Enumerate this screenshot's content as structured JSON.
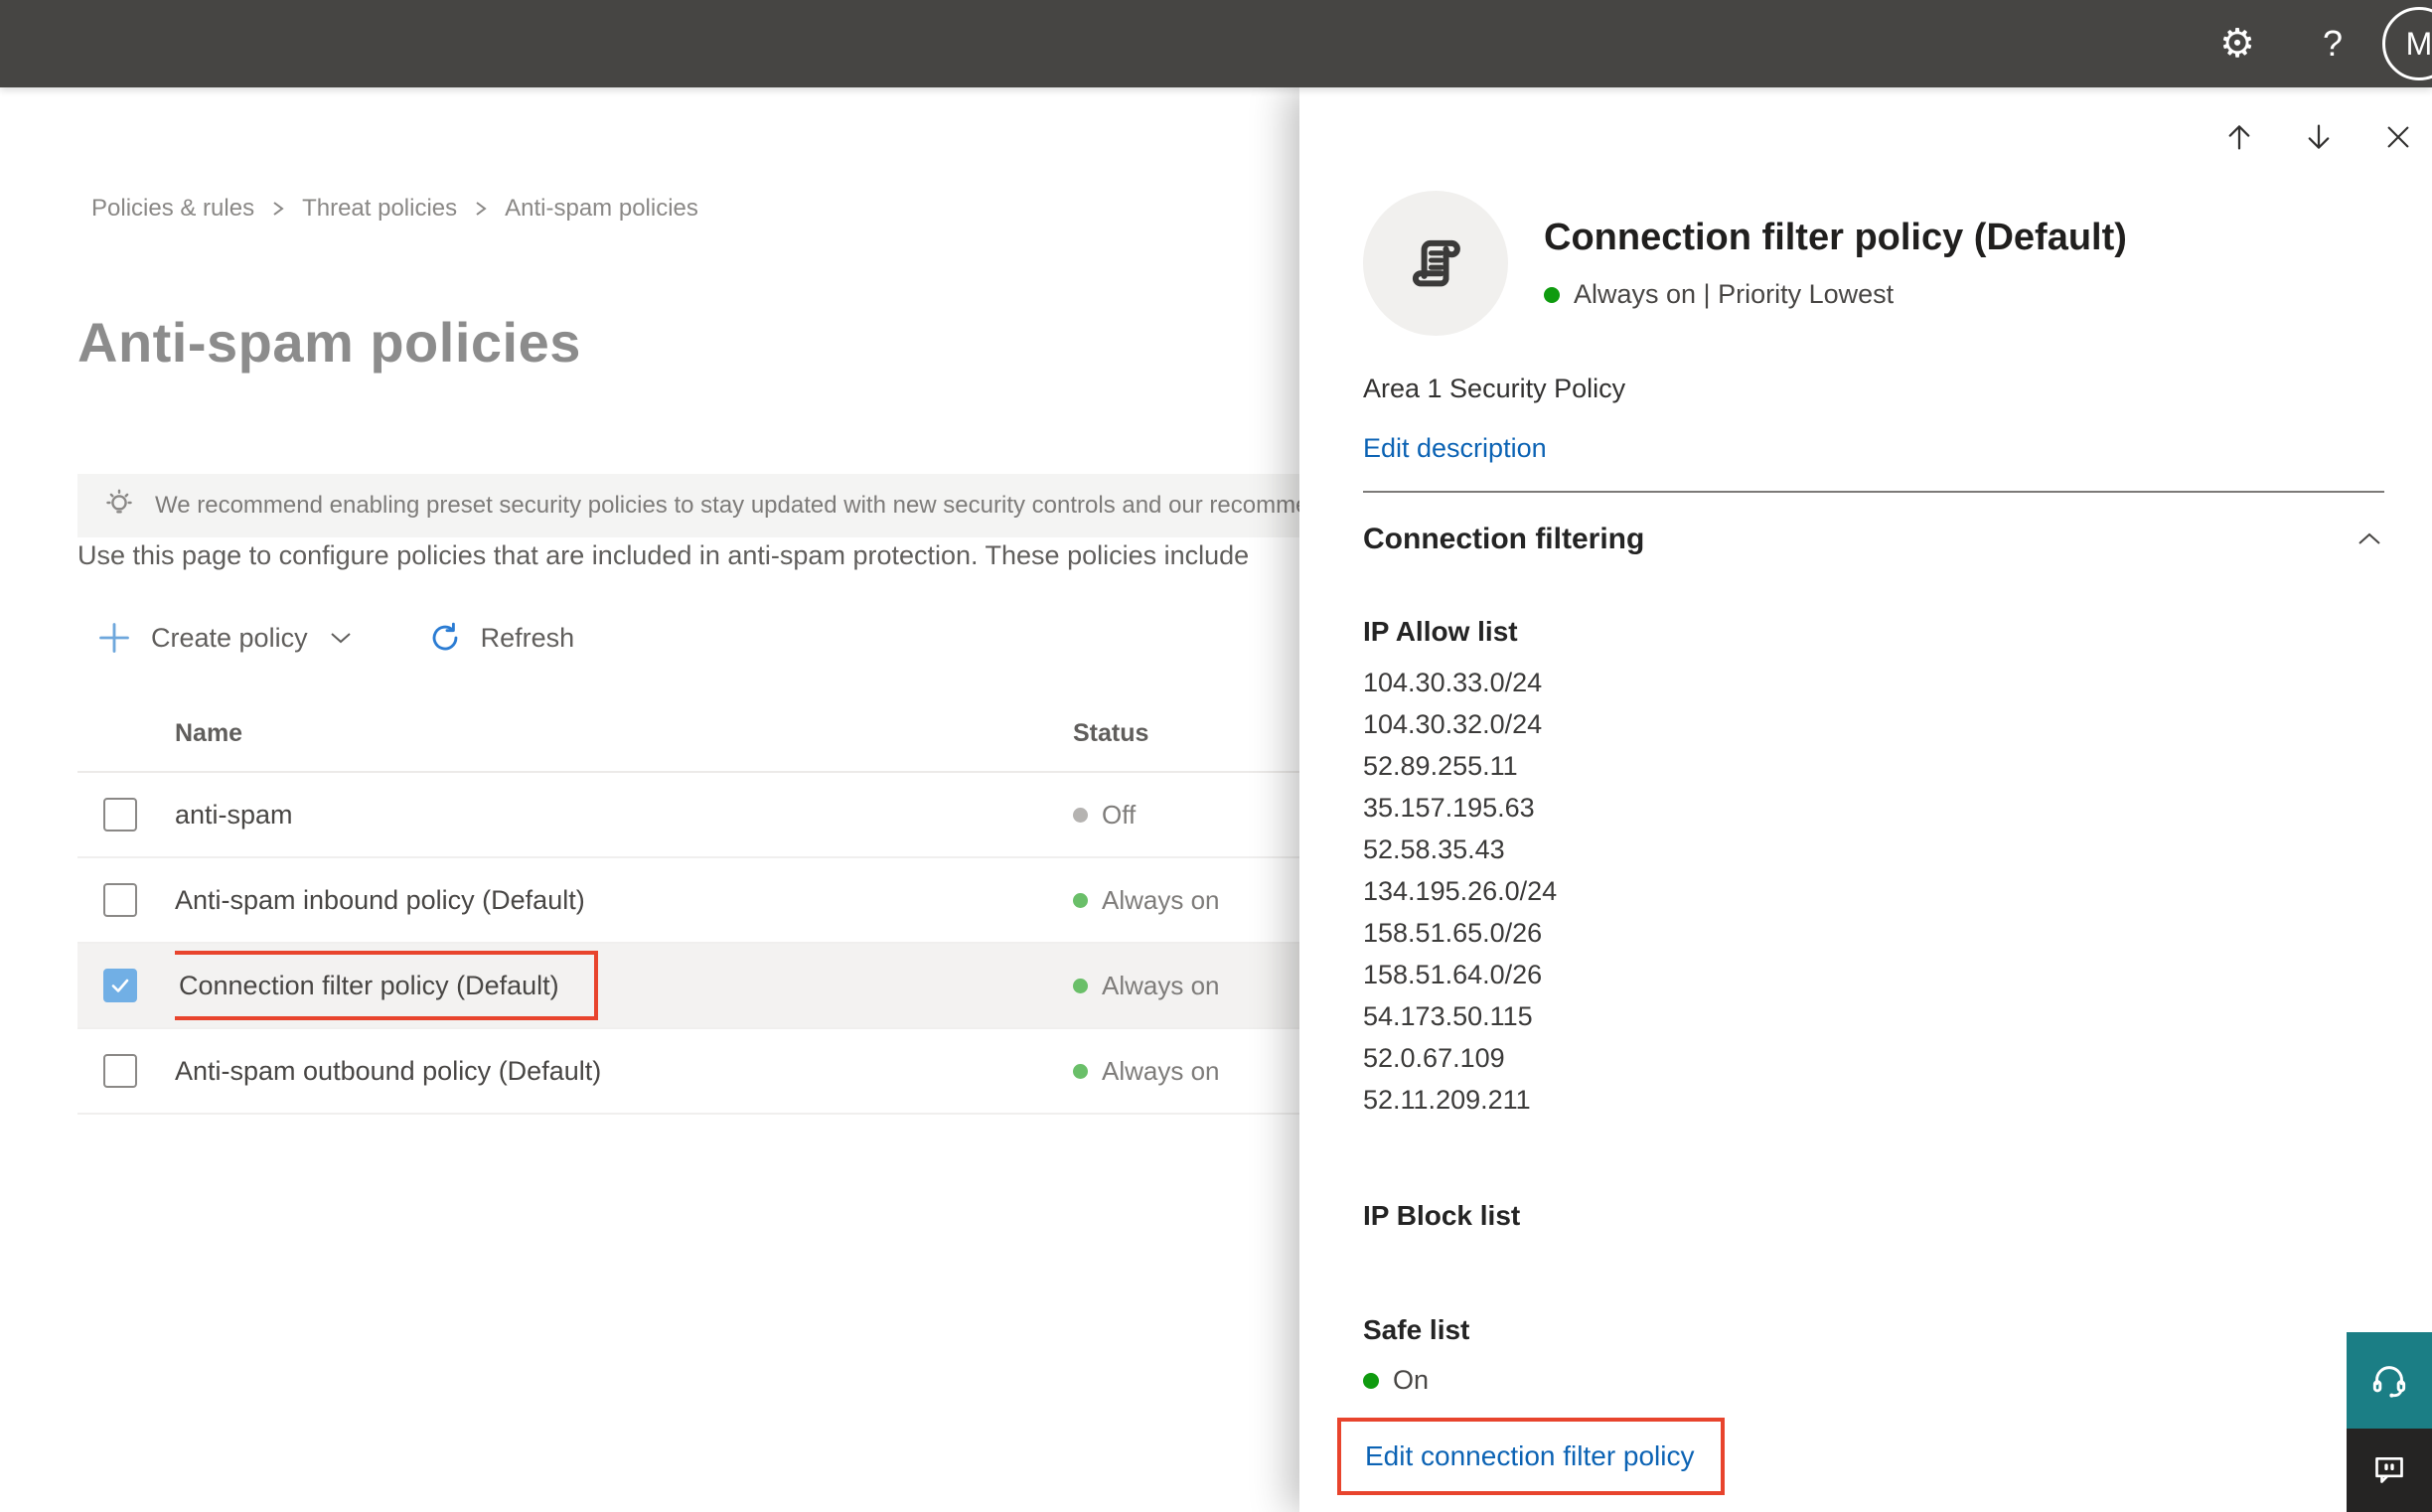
{
  "topbar": {
    "help_label": "?",
    "avatar_initial": "M"
  },
  "breadcrumb": [
    "Policies & rules",
    "Threat policies",
    "Anti-spam policies"
  ],
  "page": {
    "title": "Anti-spam policies",
    "banner": "We recommend enabling preset security policies to stay updated with new security controls and our recomme",
    "intro": "Use this page to configure policies that are included in anti-spam protection. These policies include",
    "toolbar": {
      "create": "Create policy",
      "refresh": "Refresh"
    }
  },
  "table": {
    "headers": {
      "name": "Name",
      "status": "Status"
    },
    "rows": [
      {
        "name": "anti-spam",
        "status": "Off"
      },
      {
        "name": "Anti-spam inbound policy (Default)",
        "status": "Always on"
      },
      {
        "name": "Connection filter policy (Default)",
        "status": "Always on"
      },
      {
        "name": "Anti-spam outbound policy (Default)",
        "status": "Always on"
      }
    ]
  },
  "panel": {
    "title": "Connection filter policy (Default)",
    "status": "Always on | Priority Lowest",
    "description": "Area 1 Security Policy",
    "edit_description": "Edit description",
    "section": "Connection filtering",
    "ip_allow_title": "IP Allow list",
    "ip_allow": [
      "104.30.33.0/24",
      "104.30.32.0/24",
      "52.89.255.11",
      "35.157.195.63",
      "52.58.35.43",
      "134.195.26.0/24",
      "158.51.65.0/26",
      "158.51.64.0/26",
      "54.173.50.115",
      "52.0.67.109",
      "52.11.209.211"
    ],
    "ip_block_title": "IP Block list",
    "safe_list_title": "Safe list",
    "safe_list_status": "On",
    "edit_link": "Edit connection filter policy"
  },
  "colors": {
    "topbar_bg": "#464543",
    "accent_blue": "#0c63b4",
    "checkbox_blue": "#71afe5",
    "highlight_red": "#e8442d",
    "status_green": "#6abf69",
    "status_gray": "#b5b3b1",
    "support_teal": "#1b7e85",
    "feedback_dark": "#252423"
  }
}
